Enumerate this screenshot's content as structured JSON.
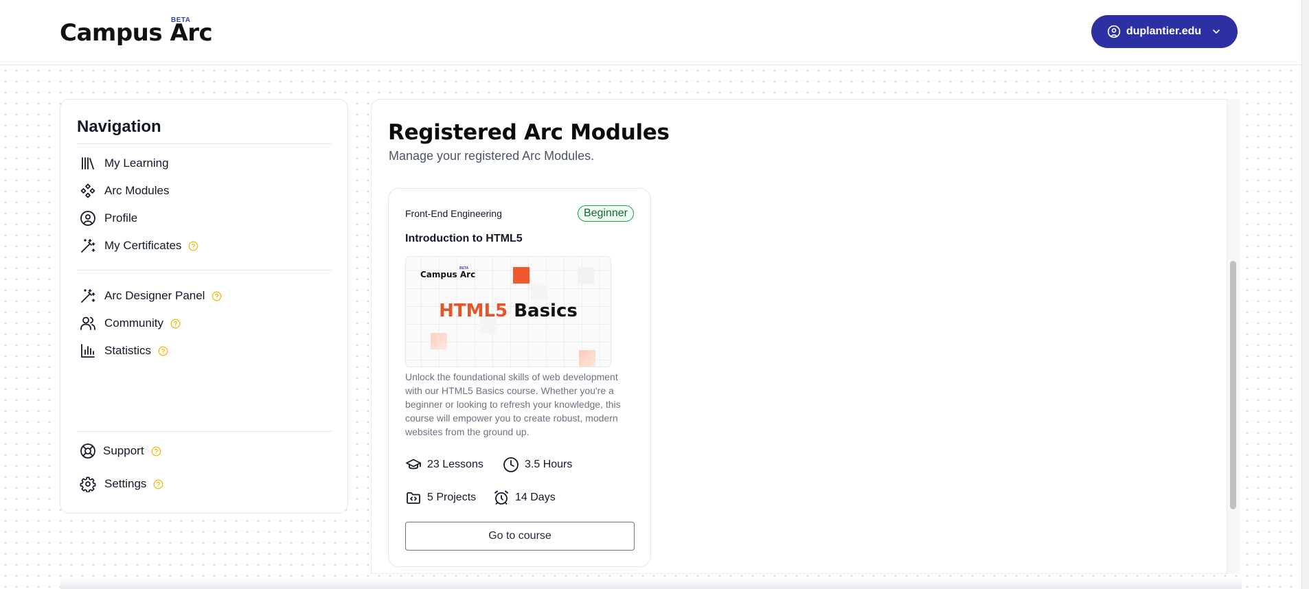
{
  "header": {
    "logo_text": "Campus Arc",
    "logo_badge": "BETA",
    "account_label": "duplantier.edu",
    "account_icon": "user-circle-icon",
    "account_chevron": "chevron-down-icon"
  },
  "sidebar": {
    "title": "Navigation",
    "primary_items": [
      {
        "label": "My Learning",
        "icon": "library-icon",
        "help": false
      },
      {
        "label": "Arc Modules",
        "icon": "component-icon",
        "help": false
      },
      {
        "label": "Profile",
        "icon": "user-circle-icon",
        "help": false
      },
      {
        "label": "My Certificates",
        "icon": "magic-wand-icon",
        "help": true
      }
    ],
    "secondary_items": [
      {
        "label": "Arc Designer Panel",
        "icon": "magic-wand-icon",
        "help": true
      },
      {
        "label": "Community",
        "icon": "users-icon",
        "help": true
      },
      {
        "label": "Statistics",
        "icon": "bar-chart-icon",
        "help": true
      }
    ],
    "footer_items": [
      {
        "label": "Support",
        "icon": "lifebuoy-icon",
        "help": true
      },
      {
        "label": "Settings",
        "icon": "gear-icon",
        "help": true
      }
    ]
  },
  "main": {
    "title": "Registered Arc Modules",
    "subtitle": "Manage your registered Arc Modules.",
    "courses": [
      {
        "category": "Front-End Engineering",
        "level": "Beginner",
        "title": "Introduction to HTML5",
        "thumbnail": {
          "logo_text": "Campus Arc",
          "logo_badge": "BETA",
          "heading_accent": "HTML5",
          "heading_rest": "Basics"
        },
        "description": "Unlock the foundational skills of web development with our HTML5 Basics course. Whether you're a beginner or looking to refresh your knowledge, this course will empower you to create robust, modern websites from the ground up.",
        "lessons": "23 Lessons",
        "hours": "3.5 Hours",
        "projects": "5 Projects",
        "days": "14 Days",
        "cta": "Go to course"
      }
    ]
  },
  "colors": {
    "primary": "#2c30a3",
    "help_icon": "#f2b705",
    "level_badge": "#16a34a",
    "thumbnail_accent": "#e2562a"
  }
}
